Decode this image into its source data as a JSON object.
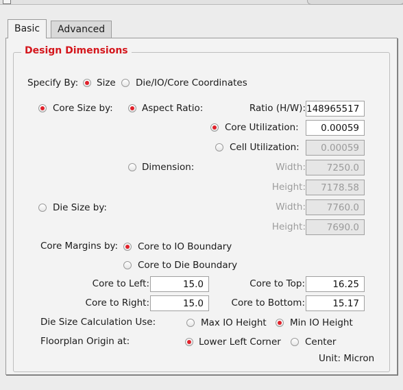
{
  "tabs": {
    "basic": "Basic",
    "advanced": "Advanced"
  },
  "group_title": "Design Dimensions",
  "specify_by": {
    "label": "Specify By:",
    "size": "Size",
    "coords": "Die/IO/Core Coordinates",
    "selected": "size"
  },
  "core_size_by": {
    "label": "Core Size by:",
    "selected": true
  },
  "aspect_ratio": {
    "label": "Aspect Ratio:",
    "selected": true,
    "ratio_label": "Ratio (H/W):",
    "ratio_value": "148965517"
  },
  "core_utilization": {
    "label": "Core Utilization:",
    "selected": true,
    "value": "0.00059"
  },
  "cell_utilization": {
    "label": "Cell Utilization:",
    "selected": false,
    "value": "0.00059"
  },
  "dimension": {
    "label": "Dimension:",
    "selected": false,
    "width_label": "Width:",
    "width_value": "7250.0",
    "height_label": "Height:",
    "height_value": "7178.58"
  },
  "die_size_by": {
    "label": "Die Size by:",
    "selected": false,
    "width_label": "Width:",
    "width_value": "7760.0",
    "height_label": "Height:",
    "height_value": "7690.0"
  },
  "core_margins": {
    "label": "Core Margins by:",
    "io_boundary": "Core to IO Boundary",
    "die_boundary": "Core to Die Boundary",
    "selected": "io"
  },
  "margins": {
    "left_label": "Core to Left:",
    "left_value": "15.0",
    "right_label": "Core to Right:",
    "right_value": "15.0",
    "top_label": "Core to Top:",
    "top_value": "16.25",
    "bottom_label": "Core to Bottom:",
    "bottom_value": "15.17"
  },
  "die_calc": {
    "label": "Die Size Calculation Use:",
    "max": "Max IO Height",
    "min": "Min IO Height",
    "selected": "min"
  },
  "origin": {
    "label": "Floorplan Origin at:",
    "lower_left": "Lower Left Corner",
    "center": "Center",
    "selected": "lower_left"
  },
  "unit": "Unit: Micron"
}
